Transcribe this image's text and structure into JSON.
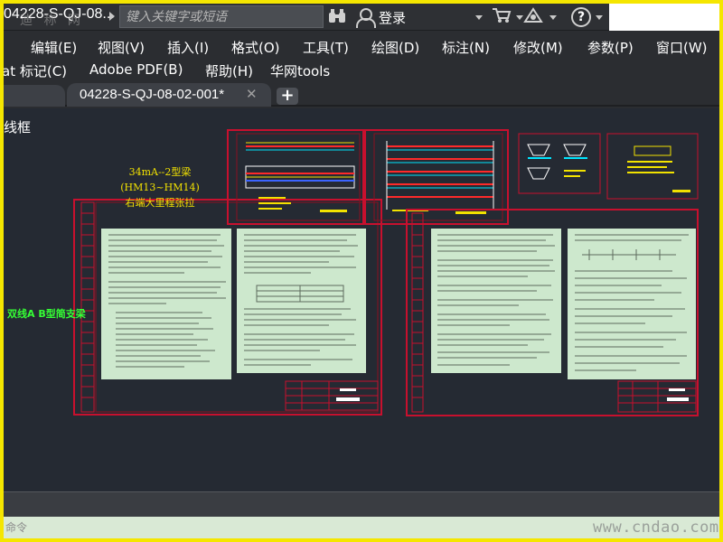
{
  "titlebar": {
    "doc_title": "04228-S-QJ-08...",
    "watermark": "迪 称 网",
    "search_placeholder": "键入关键字或短语",
    "binoculars_icon": "binoculars-icon",
    "login_label": "登录",
    "help_glyph": "?"
  },
  "menu": {
    "row1": [
      "编辑(E)",
      "视图(V)",
      "插入(I)",
      "格式(O)",
      "工具(T)",
      "绘图(D)",
      "标注(N)",
      "修改(M)",
      "参数(P)",
      "窗口(W)"
    ],
    "row2": [
      "at 标记(C)",
      "Adobe PDF(B)",
      "帮助(H)",
      "华网tools"
    ]
  },
  "tabs": {
    "active_label": "04228-S-QJ-08-02-001*",
    "close_glyph": "✕",
    "add_glyph": "+"
  },
  "canvas": {
    "viewport_label": "线框",
    "drawing_title_line1": "34mA--2型梁(HM13~HM14)",
    "drawing_title_line2": "右端大里程张拉",
    "side_label": "双线A B型简支梁"
  },
  "command": {
    "placeholder": "命令"
  },
  "watermark_bottom": "www.cndao.com",
  "colors": {
    "canvas_bg": "#252a33",
    "sheet_bg": "#cde8cd",
    "frame_red": "#c8102e",
    "title_yellow": "#f2e200",
    "label_green": "#35ff35",
    "outer_border": "#f5e600"
  }
}
